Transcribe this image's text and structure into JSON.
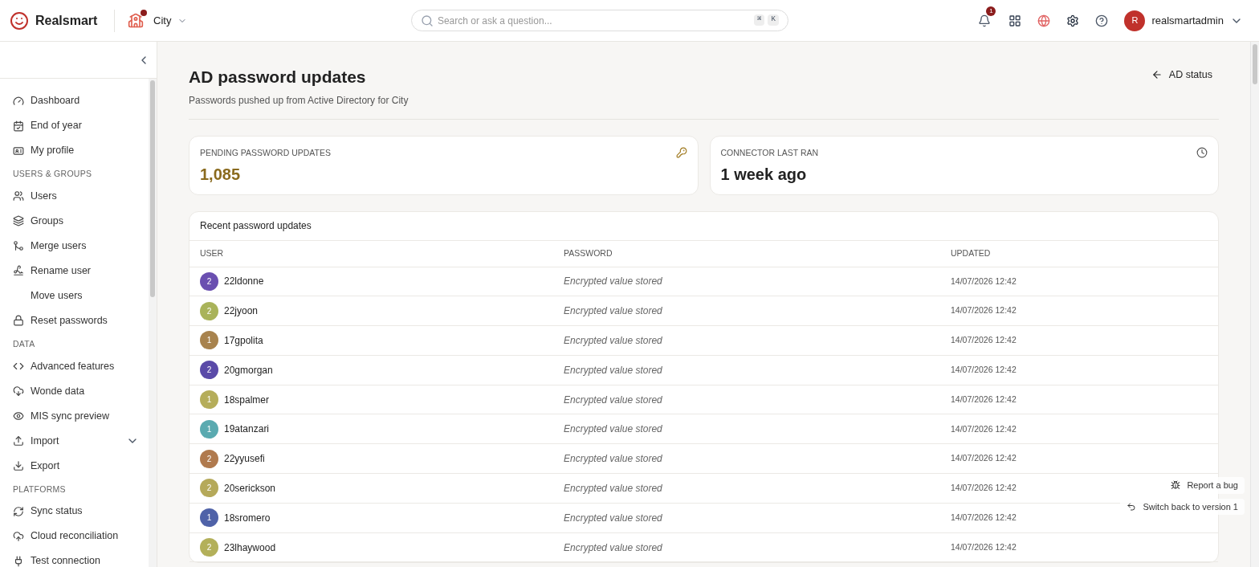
{
  "header": {
    "brand": "Realsmart",
    "school": {
      "name": "City"
    },
    "search": {
      "placeholder": "Search or ask a question...",
      "keys": [
        "⌘",
        "K"
      ]
    },
    "notifications": {
      "count": "1"
    },
    "user": {
      "initial": "R",
      "name": "realsmartadmin"
    }
  },
  "sidebar": {
    "sections": [
      {
        "items": [
          {
            "label": "Dashboard"
          },
          {
            "label": "End of year"
          },
          {
            "label": "My profile"
          }
        ]
      },
      {
        "title": "USERS & GROUPS",
        "items": [
          {
            "label": "Users"
          },
          {
            "label": "Groups"
          },
          {
            "label": "Merge users"
          },
          {
            "label": "Rename user"
          },
          {
            "label": "Move users"
          },
          {
            "label": "Reset passwords"
          }
        ]
      },
      {
        "title": "DATA",
        "items": [
          {
            "label": "Advanced features"
          },
          {
            "label": "Wonde data"
          },
          {
            "label": "MIS sync preview"
          },
          {
            "label": "Import"
          },
          {
            "label": "Export"
          }
        ]
      },
      {
        "title": "PLATFORMS",
        "items": [
          {
            "label": "Sync status"
          },
          {
            "label": "Cloud reconciliation"
          },
          {
            "label": "Test connection"
          }
        ]
      }
    ]
  },
  "page": {
    "title": "AD password updates",
    "subtitle": "Passwords pushed up from Active Directory for City",
    "back_link": "AD status"
  },
  "stats": [
    {
      "label": "PENDING PASSWORD UPDATES",
      "value": "1,085",
      "accent": true
    },
    {
      "label": "CONNECTOR LAST RAN",
      "value": "1 week ago",
      "accent": false
    }
  ],
  "table": {
    "title": "Recent password updates",
    "columns": [
      "USER",
      "PASSWORD",
      "UPDATED"
    ],
    "rows": [
      {
        "badge": "2",
        "color": "#6a4fb0",
        "user": "22ldonne",
        "password": "Encrypted value stored",
        "updated": "14/07/2026 12:42"
      },
      {
        "badge": "2",
        "color": "#a9b35a",
        "user": "22jyoon",
        "password": "Encrypted value stored",
        "updated": "14/07/2026 12:42"
      },
      {
        "badge": "1",
        "color": "#a8834e",
        "user": "17gpolita",
        "password": "Encrypted value stored",
        "updated": "14/07/2026 12:42"
      },
      {
        "badge": "2",
        "color": "#5a4aa8",
        "user": "20gmorgan",
        "password": "Encrypted value stored",
        "updated": "14/07/2026 12:42"
      },
      {
        "badge": "1",
        "color": "#b5ad5a",
        "user": "18spalmer",
        "password": "Encrypted value stored",
        "updated": "14/07/2026 12:42"
      },
      {
        "badge": "1",
        "color": "#5aaab0",
        "user": "19atanzari",
        "password": "Encrypted value stored",
        "updated": "14/07/2026 12:42"
      },
      {
        "badge": "2",
        "color": "#b07a4e",
        "user": "22yyusefi",
        "password": "Encrypted value stored",
        "updated": "14/07/2026 12:42"
      },
      {
        "badge": "2",
        "color": "#b5a95a",
        "user": "20serickson",
        "password": "Encrypted value stored",
        "updated": "14/07/2026 12:42"
      },
      {
        "badge": "1",
        "color": "#4f62a8",
        "user": "18sromero",
        "password": "Encrypted value stored",
        "updated": "14/07/2026 12:42"
      },
      {
        "badge": "2",
        "color": "#b3b05a",
        "user": "23lhaywood",
        "password": "Encrypted value stored",
        "updated": "14/07/2026 12:42"
      }
    ]
  },
  "floating": [
    {
      "label": "Report a bug"
    },
    {
      "label": "Switch back to version 1"
    }
  ]
}
